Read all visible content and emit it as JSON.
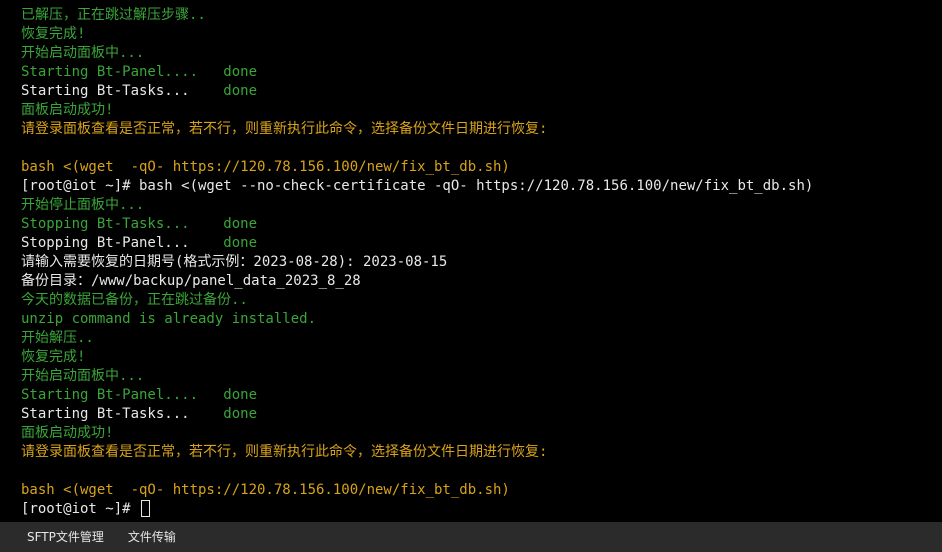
{
  "terminal": {
    "lines": [
      {
        "text": "已解压，正在跳过解压步骤..",
        "color": "g"
      },
      {
        "text": "恢复完成!",
        "color": "g"
      },
      {
        "text": "开始启动面板中...",
        "color": "g"
      },
      {
        "text": "Starting Bt-Panel....   done",
        "color": "g"
      },
      {
        "text": "Starting Bt-Tasks...    done",
        "color": "w",
        "done_color": "g"
      },
      {
        "text": "面板启动成功!",
        "color": "g"
      },
      {
        "text": "请登录面板查看是否正常，若不行，则重新执行此命令，选择备份文件日期进行恢复:",
        "color": "y"
      },
      {
        "text": "",
        "color": "w"
      },
      {
        "text": "bash <(wget  -qO- https://120.78.156.100/new/fix_bt_db.sh)",
        "color": "y"
      },
      {
        "text": "[root@iot ~]# bash <(wget --no-check-certificate -qO- https://120.78.156.100/new/fix_bt_db.sh)",
        "color": "w"
      },
      {
        "text": "开始停止面板中...",
        "color": "g"
      },
      {
        "text": "Stopping Bt-Tasks...    done",
        "color": "g"
      },
      {
        "text": "Stopping Bt-Panel...    done",
        "color": "w",
        "done_color": "g"
      },
      {
        "text": "请输入需要恢复的日期号(格式示例：2023-08-28): 2023-08-15",
        "color": "w"
      },
      {
        "text": "备份目录：/www/backup/panel_data_2023_8_28",
        "color": "w"
      },
      {
        "text": "今天的数据已备份，正在跳过备份..",
        "color": "g"
      },
      {
        "text": "unzip command is already installed.",
        "color": "g"
      },
      {
        "text": "开始解压..",
        "color": "g"
      },
      {
        "text": "恢复完成!",
        "color": "g"
      },
      {
        "text": "开始启动面板中...",
        "color": "g"
      },
      {
        "text": "Starting Bt-Panel....   done",
        "color": "g"
      },
      {
        "text": "Starting Bt-Tasks...    done",
        "color": "w",
        "done_color": "g"
      },
      {
        "text": "面板启动成功!",
        "color": "g"
      },
      {
        "text": "请登录面板查看是否正常，若不行，则重新执行此命令，选择备份文件日期进行恢复:",
        "color": "y"
      },
      {
        "text": "",
        "color": "w"
      },
      {
        "text": "bash <(wget  -qO- https://120.78.156.100/new/fix_bt_db.sh)",
        "color": "y"
      },
      {
        "text": "[root@iot ~]# ",
        "color": "w",
        "cursor": true
      }
    ]
  },
  "statusbar": {
    "tabs": [
      "SFTP文件管理",
      "文件传输"
    ]
  }
}
